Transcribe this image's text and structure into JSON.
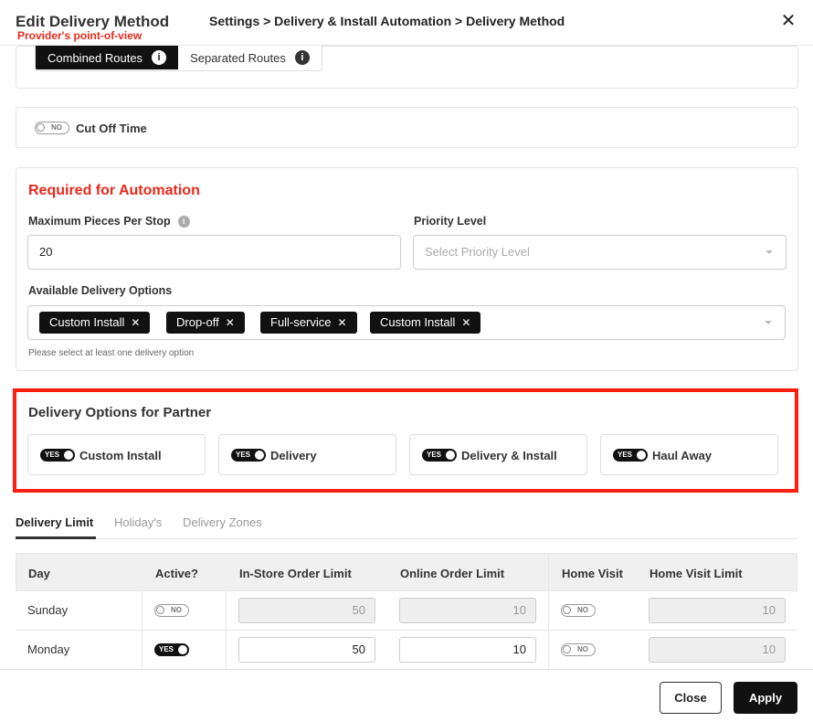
{
  "header": {
    "title": "Edit Delivery Method",
    "subtitle": "Provider's point-of-view",
    "breadcrumb": "Settings > Delivery & Install Automation > Delivery Method",
    "close_glyph": "✕"
  },
  "routes": {
    "combined_label": "Combined Routes",
    "separated_label": "Separated Routes",
    "info_glyph": "i",
    "selected": "Combined Routes"
  },
  "cutoff": {
    "toggle_label": "NO",
    "label": "Cut Off Time"
  },
  "automation": {
    "title": "Required for Automation",
    "max_pieces_label": "Maximum Pieces Per Stop",
    "max_pieces_value": "20",
    "priority_label": "Priority Level",
    "priority_placeholder": "Select Priority Level",
    "options_label": "Available Delivery Options",
    "options": [
      "Custom Install",
      "Drop-off",
      "Full-service",
      "Custom Install"
    ],
    "chip_remove_glyph": "✕",
    "hint": "Please select at least one delivery option"
  },
  "partner": {
    "title": "Delivery Options for Partner",
    "options": [
      {
        "label": "Custom Install",
        "toggle": "YES"
      },
      {
        "label": "Delivery",
        "toggle": "YES"
      },
      {
        "label": "Delivery & Install",
        "toggle": "YES"
      },
      {
        "label": "Haul Away",
        "toggle": "YES"
      }
    ]
  },
  "tabs": [
    "Delivery Limit",
    "Holiday's",
    "Delivery Zones"
  ],
  "active_tab": "Delivery Limit",
  "table": {
    "headers": [
      "Day",
      "Active?",
      "In-Store Order Limit",
      "Online Order Limit",
      "Home Visit",
      "Home Visit Limit"
    ],
    "rows": [
      {
        "day": "Sunday",
        "active": "NO",
        "in_store": "50",
        "online": "10",
        "home_visit": "NO",
        "home_visit_limit": "10"
      },
      {
        "day": "Monday",
        "active": "YES",
        "in_store": "50",
        "online": "10",
        "home_visit": "NO",
        "home_visit_limit": "10"
      }
    ]
  },
  "footer": {
    "close_label": "Close",
    "apply_label": "Apply"
  },
  "colors": {
    "accent_red": "#e8291c",
    "highlight_border": "#ff1f0f",
    "dark": "#111111"
  }
}
